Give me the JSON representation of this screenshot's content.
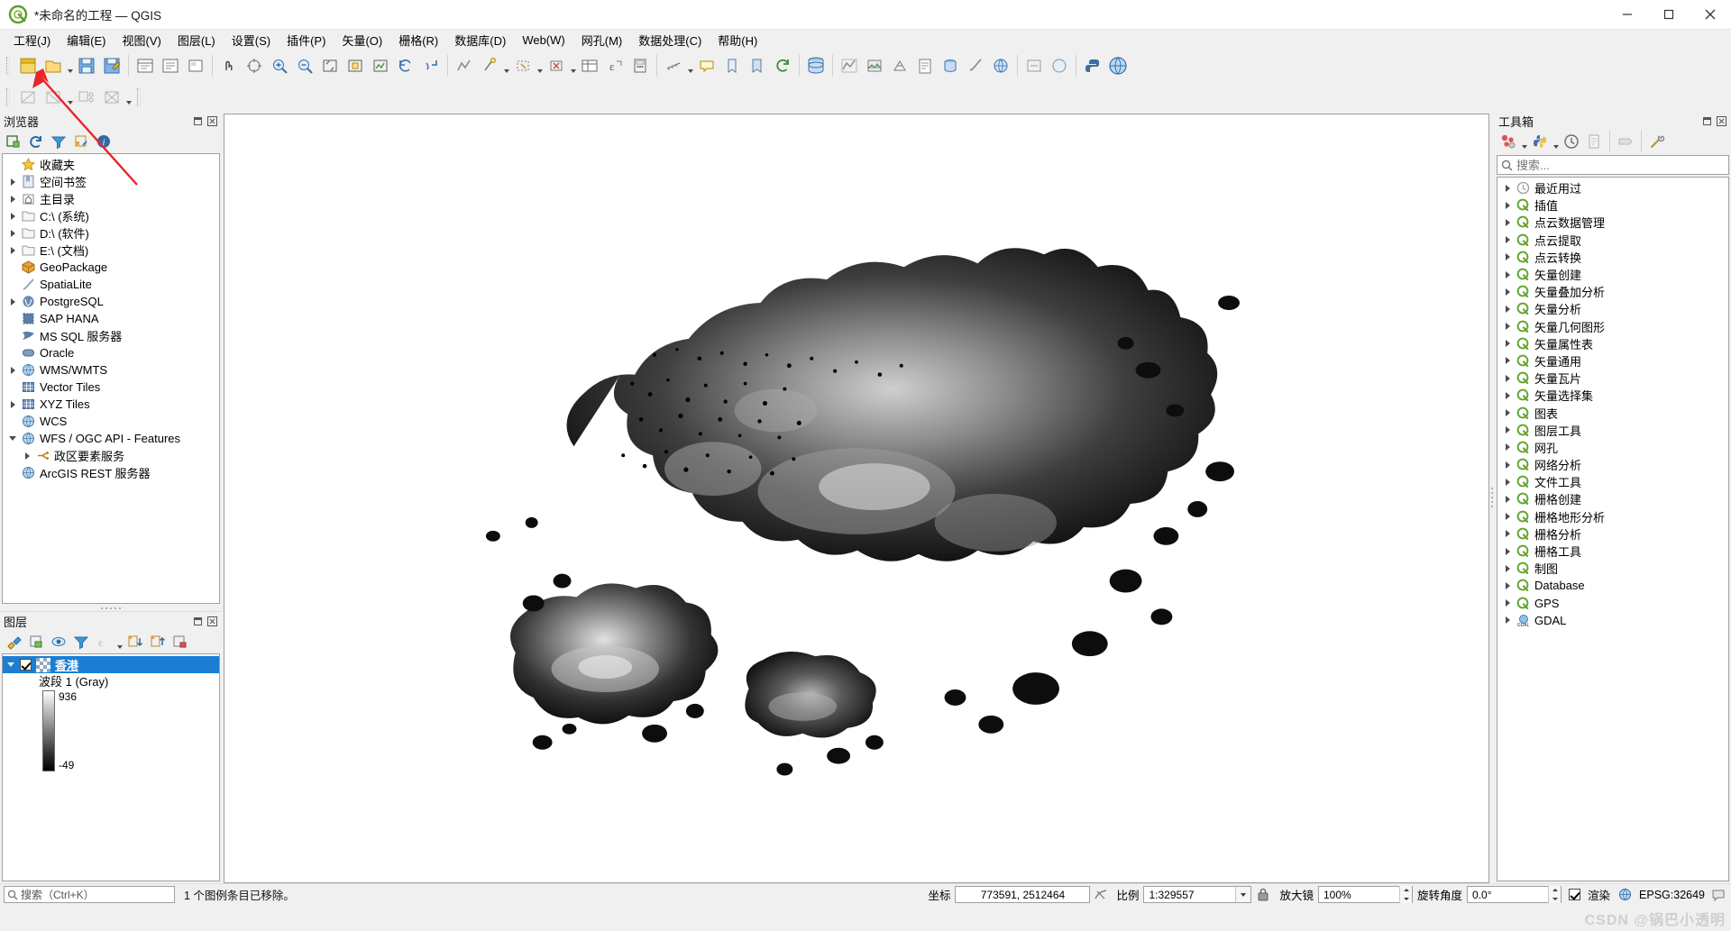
{
  "window": {
    "title": "*未命名的工程 — QGIS",
    "minimize": "—",
    "maximize": "▢",
    "close": "✕"
  },
  "menubar": [
    {
      "label": "工程(J)"
    },
    {
      "label": "编辑(E)"
    },
    {
      "label": "视图(V)"
    },
    {
      "label": "图层(L)"
    },
    {
      "label": "设置(S)"
    },
    {
      "label": "插件(P)"
    },
    {
      "label": "矢量(O)"
    },
    {
      "label": "栅格(R)"
    },
    {
      "label": "数据库(D)"
    },
    {
      "label": "Web(W)"
    },
    {
      "label": "网孔(M)"
    },
    {
      "label": "数据处理(C)"
    },
    {
      "label": "帮助(H)"
    }
  ],
  "browser": {
    "title": "浏览器",
    "tools": [
      {
        "name": "add-layer-icon"
      },
      {
        "name": "refresh-icon"
      },
      {
        "name": "filter-icon"
      },
      {
        "name": "collapse-all-icon"
      },
      {
        "name": "properties-icon"
      }
    ],
    "items": [
      {
        "label": "收藏夹",
        "icon": "star-icon",
        "expandable": false,
        "indent": 0
      },
      {
        "label": "空间书签",
        "icon": "bookmark-icon",
        "expandable": true,
        "indent": 0
      },
      {
        "label": "主目录",
        "icon": "home-icon",
        "expandable": true,
        "indent": 0
      },
      {
        "label": "C:\\ (系统)",
        "icon": "folder-icon",
        "expandable": true,
        "indent": 0
      },
      {
        "label": "D:\\ (软件)",
        "icon": "folder-icon",
        "expandable": true,
        "indent": 0
      },
      {
        "label": "E:\\ (文档)",
        "icon": "folder-icon",
        "expandable": true,
        "indent": 0
      },
      {
        "label": "GeoPackage",
        "icon": "geopackage-icon",
        "expandable": false,
        "indent": 0
      },
      {
        "label": "SpatiaLite",
        "icon": "spatialite-icon",
        "expandable": false,
        "indent": 0
      },
      {
        "label": "PostgreSQL",
        "icon": "postgres-icon",
        "expandable": true,
        "indent": 0
      },
      {
        "label": "SAP HANA",
        "icon": "saphana-icon",
        "expandable": false,
        "indent": 0
      },
      {
        "label": "MS SQL 服务器",
        "icon": "mssql-icon",
        "expandable": false,
        "indent": 0
      },
      {
        "label": "Oracle",
        "icon": "oracle-icon",
        "expandable": false,
        "indent": 0
      },
      {
        "label": "WMS/WMTS",
        "icon": "globe-icon",
        "expandable": true,
        "indent": 0
      },
      {
        "label": "Vector Tiles",
        "icon": "grid-icon",
        "expandable": false,
        "indent": 0
      },
      {
        "label": "XYZ Tiles",
        "icon": "grid-icon",
        "expandable": true,
        "indent": 0
      },
      {
        "label": "WCS",
        "icon": "globe-icon",
        "expandable": false,
        "indent": 0
      },
      {
        "label": "WFS / OGC API - Features",
        "icon": "globe-icon",
        "expandable": true,
        "indent": 0
      },
      {
        "label": "政区要素服务",
        "icon": "wfs-node-icon",
        "expandable": true,
        "indent": 1
      },
      {
        "label": "ArcGIS REST 服务器",
        "icon": "globe-icon",
        "expandable": false,
        "indent": 0
      }
    ]
  },
  "layers": {
    "title": "图层",
    "tools": [
      {
        "name": "open-layer-styling-icon"
      },
      {
        "name": "add-group-icon"
      },
      {
        "name": "manage-map-themes-icon"
      },
      {
        "name": "filter-legend-icon"
      },
      {
        "name": "filter-legend-expression-icon"
      },
      {
        "name": "expand-all-icon"
      },
      {
        "name": "collapse-all-icon"
      },
      {
        "name": "remove-layer-icon"
      }
    ],
    "layer_name": "香港",
    "checked": true,
    "band_label": "波段 1 (Gray)",
    "ramp_max": "936",
    "ramp_min": "-49"
  },
  "toolbox": {
    "title": "工具箱",
    "tools": [
      {
        "name": "models-icon"
      },
      {
        "name": "python-script-icon"
      },
      {
        "name": "history-icon"
      },
      {
        "name": "results-viewer-icon"
      },
      {
        "name": "edit-features-inplace-icon"
      },
      {
        "name": "options-icon"
      }
    ],
    "search_placeholder": "搜索...",
    "items": [
      {
        "label": "最近用过",
        "icon": "clock-icon"
      },
      {
        "label": "插值",
        "icon": "qgis-icon"
      },
      {
        "label": "点云数据管理",
        "icon": "qgis-icon"
      },
      {
        "label": "点云提取",
        "icon": "qgis-icon"
      },
      {
        "label": "点云转换",
        "icon": "qgis-icon"
      },
      {
        "label": "矢量创建",
        "icon": "qgis-icon"
      },
      {
        "label": "矢量叠加分析",
        "icon": "qgis-icon"
      },
      {
        "label": "矢量分析",
        "icon": "qgis-icon"
      },
      {
        "label": "矢量几何图形",
        "icon": "qgis-icon"
      },
      {
        "label": "矢量属性表",
        "icon": "qgis-icon"
      },
      {
        "label": "矢量通用",
        "icon": "qgis-icon"
      },
      {
        "label": "矢量瓦片",
        "icon": "qgis-icon"
      },
      {
        "label": "矢量选择集",
        "icon": "qgis-icon"
      },
      {
        "label": "图表",
        "icon": "qgis-icon"
      },
      {
        "label": "图层工具",
        "icon": "qgis-icon"
      },
      {
        "label": "网孔",
        "icon": "qgis-icon"
      },
      {
        "label": "网络分析",
        "icon": "qgis-icon"
      },
      {
        "label": "文件工具",
        "icon": "qgis-icon"
      },
      {
        "label": "栅格创建",
        "icon": "qgis-icon"
      },
      {
        "label": "栅格地形分析",
        "icon": "qgis-icon"
      },
      {
        "label": "栅格分析",
        "icon": "qgis-icon"
      },
      {
        "label": "栅格工具",
        "icon": "qgis-icon"
      },
      {
        "label": "制图",
        "icon": "qgis-icon"
      },
      {
        "label": "Database",
        "icon": "qgis-icon"
      },
      {
        "label": "GPS",
        "icon": "qgis-icon"
      },
      {
        "label": "GDAL",
        "icon": "gdal-icon"
      }
    ]
  },
  "statusbar": {
    "search_placeholder": "搜索（Ctrl+K）",
    "message": "1 个图例条目已移除。",
    "coord_label": "坐标",
    "coord_value": "773591, 2512464",
    "scale_label": "比例",
    "scale_value": "1:329557",
    "magnifier_label": "放大镜",
    "magnifier_value": "100%",
    "rotation_label": "旋转角度",
    "rotation_value": "0.0°",
    "render_label": "渲染",
    "render_checked": true,
    "epsg": "EPSG:32649"
  },
  "watermark": "CSDN @锅巴小透明",
  "colors": {
    "accent": "#1a7fd4",
    "qgis_green": "#62a52b",
    "annotation_red": "#e8262a",
    "panel_bg": "#f0f0f0"
  }
}
